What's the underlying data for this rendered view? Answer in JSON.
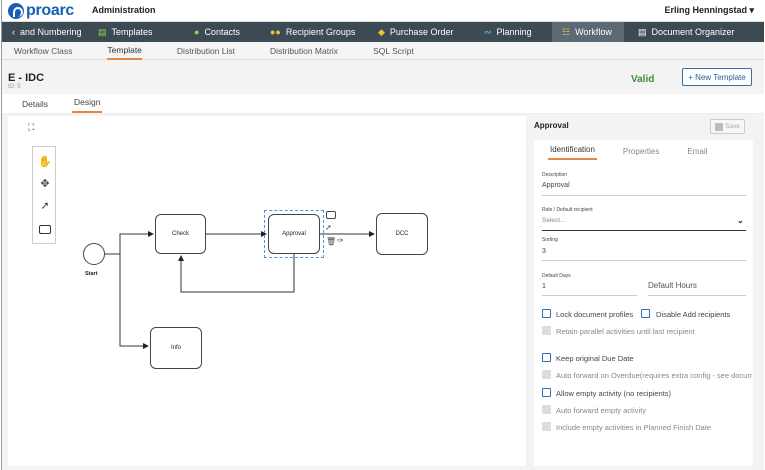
{
  "topbar": {
    "brand": "proarc",
    "section": "Administration",
    "user": "Erling Henningstad ▾"
  },
  "mainnav": {
    "items": [
      {
        "label": "and Numbering",
        "icon": "chevron-left-icon"
      },
      {
        "label": "Templates",
        "icon": "document-icon"
      },
      {
        "label": "Contacts",
        "icon": "person-icon"
      },
      {
        "label": "Recipient Groups",
        "icon": "group-icon"
      },
      {
        "label": "Purchase Order",
        "icon": "handshake-icon"
      },
      {
        "label": "Planning",
        "icon": "chart-icon"
      },
      {
        "label": "Workflow",
        "icon": "workflow-icon"
      },
      {
        "label": "Document Organizer",
        "icon": "organizer-icon"
      }
    ],
    "active": "Workflow"
  },
  "subnav": {
    "items": [
      "Workflow Class",
      "Template",
      "Distribution List",
      "Distribution Matrix",
      "SQL Script"
    ],
    "active": "Template"
  },
  "header": {
    "title": "E - IDC",
    "id_label": "ID: 5",
    "status": "Valid",
    "new_template_label": "+ New Template"
  },
  "tabs": {
    "items": [
      "Details",
      "Design"
    ],
    "active": "Design"
  },
  "diagram": {
    "nodes": {
      "start": "Start",
      "check": "Check",
      "approval": "Approval",
      "dcc": "DCC",
      "info": "Info"
    }
  },
  "panel": {
    "title": "Approval",
    "save_label": "Save",
    "tabs": [
      "Identification",
      "Properties",
      "Email"
    ],
    "active_tab": "Identification",
    "description_label": "Description",
    "description_value": "Approval",
    "role_label": "Role / Default recipient",
    "role_placeholder": "Select...",
    "sorting_label": "Sorting",
    "sorting_value": "3",
    "default_days_label": "Default Days",
    "default_days_value": "1",
    "default_hours_label": "Default Hours",
    "checkboxes": [
      {
        "label": "Lock document profiles",
        "enabled": true
      },
      {
        "label": "Disable Add recipients",
        "enabled": true
      },
      {
        "label": "Retain parallel activities until last recipient",
        "enabled": false
      },
      {
        "label": "Keep original Due Date",
        "enabled": true
      },
      {
        "label": "Auto forward on Overdue(requires extra config - see docum",
        "enabled": false
      },
      {
        "label": "Allow empty activity (no recipients)",
        "enabled": true
      },
      {
        "label": "Auto forward empty activity",
        "enabled": false
      },
      {
        "label": "Include empty activities in Planned Finish Date",
        "enabled": false
      }
    ]
  },
  "colors": {
    "nav_bg": "#3c4a54",
    "nav_active": "#5b6a74",
    "accent_orange": "#e08a4a",
    "brand_blue": "#1b5fb4",
    "valid_green": "#3c8d3c"
  }
}
